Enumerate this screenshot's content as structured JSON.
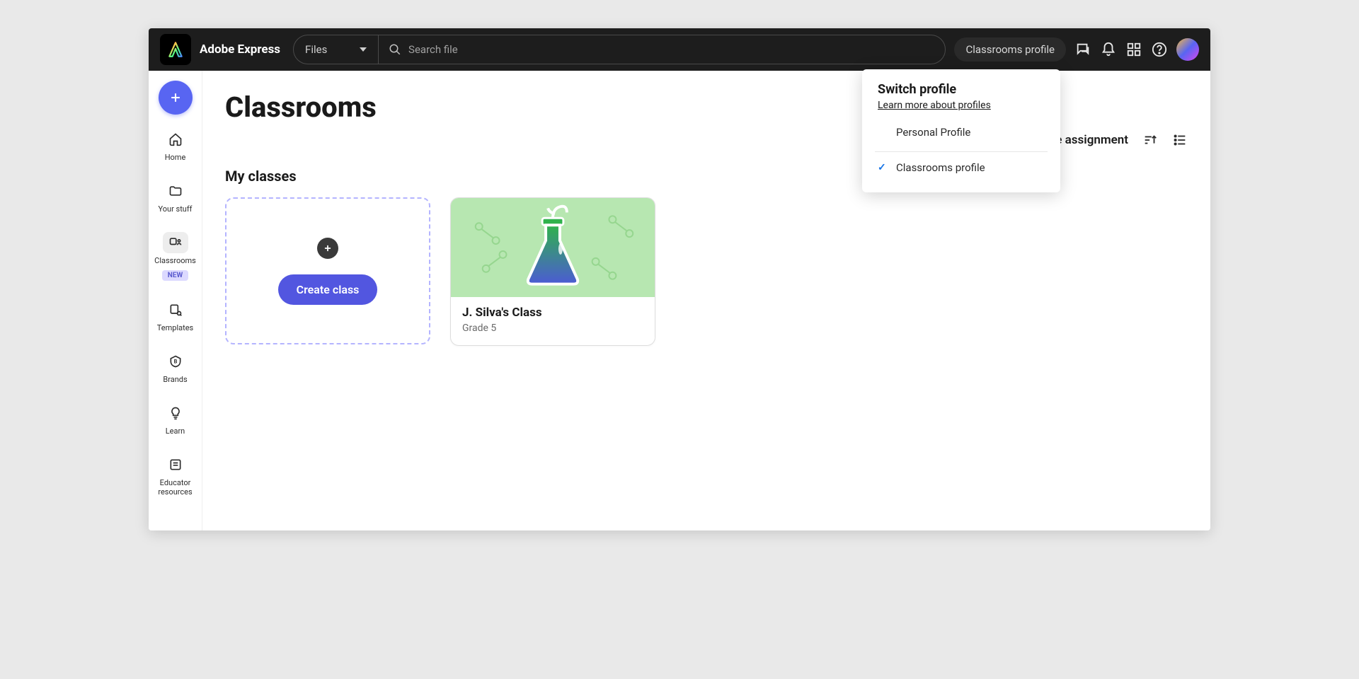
{
  "app": {
    "title": "Adobe Express"
  },
  "search": {
    "dropdown_label": "Files",
    "placeholder": "Search file"
  },
  "header": {
    "profile_button": "Classrooms profile"
  },
  "profile_dropdown": {
    "title": "Switch profile",
    "learn_more": "Learn more about profiles",
    "items": [
      {
        "label": "Personal Profile",
        "selected": false
      },
      {
        "label": "Classrooms profile",
        "selected": true
      }
    ]
  },
  "sidebar": {
    "items": [
      {
        "label": "Home"
      },
      {
        "label": "Your stuff"
      },
      {
        "label": "Classrooms",
        "badge": "NEW",
        "active": true
      },
      {
        "label": "Templates"
      },
      {
        "label": "Brands"
      },
      {
        "label": "Learn"
      },
      {
        "label": "Educator resources"
      }
    ]
  },
  "main": {
    "title": "Classrooms",
    "create_assignment": "Create assignment",
    "section_title": "My classes",
    "create_class_button": "Create class",
    "classes": [
      {
        "name": "J. Silva's Class",
        "subtitle": "Grade 5"
      }
    ]
  }
}
